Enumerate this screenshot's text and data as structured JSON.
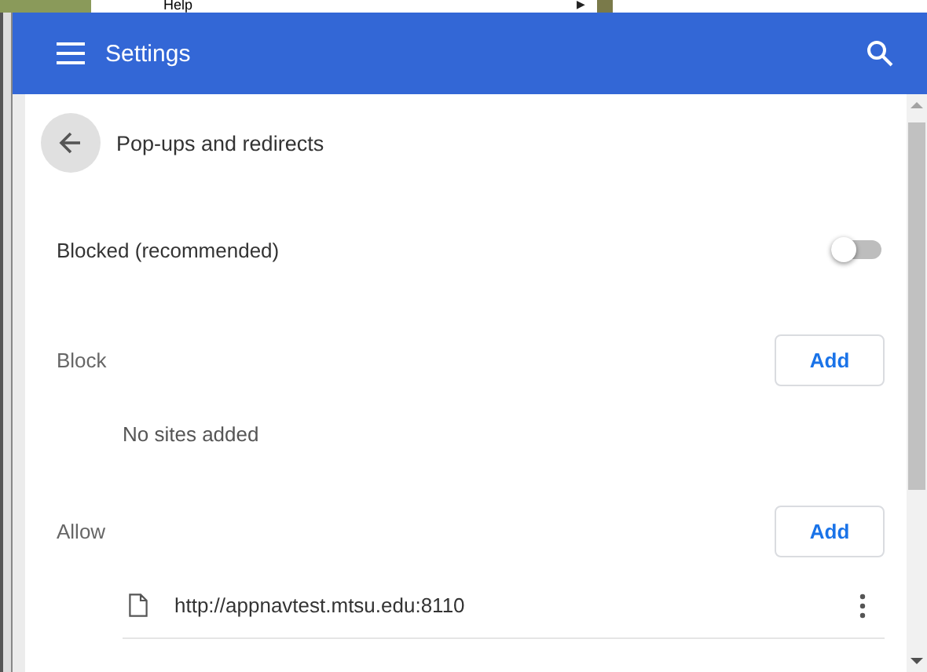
{
  "top_strip": {
    "menu_item": "Help",
    "submenu_arrow": "▶"
  },
  "app_bar": {
    "title": "Settings"
  },
  "page": {
    "title": "Pop-ups and redirects"
  },
  "blocked_setting": {
    "label": "Blocked (recommended)",
    "on": false
  },
  "sections": [
    {
      "title": "Block",
      "button": "Add",
      "empty_text": "No sites added"
    },
    {
      "title": "Allow",
      "button": "Add",
      "sites": [
        {
          "url": "http://appnavtest.mtsu.edu:8110"
        }
      ]
    }
  ]
}
